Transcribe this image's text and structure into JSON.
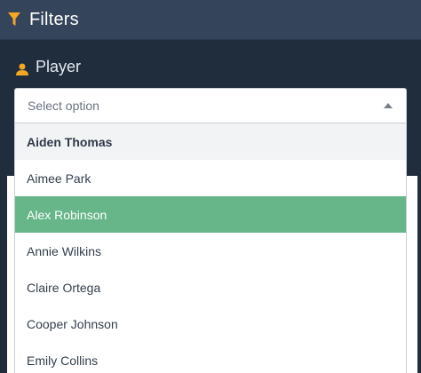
{
  "header": {
    "title": "Filters",
    "icon": "filter-icon",
    "icon_color": "#f5a623",
    "background": "#34445a"
  },
  "player_field": {
    "label": "Player",
    "icon": "user-icon",
    "icon_color": "#f5a623",
    "placeholder": "Select option"
  },
  "dropdown": {
    "options": [
      {
        "label": "Aiden Thomas",
        "state": "group-header"
      },
      {
        "label": "Aimee Park",
        "state": "normal"
      },
      {
        "label": "Alex Robinson",
        "state": "highlighted"
      },
      {
        "label": "Annie Wilkins",
        "state": "normal"
      },
      {
        "label": "Claire Ortega",
        "state": "normal"
      },
      {
        "label": "Cooper Johnson",
        "state": "normal"
      },
      {
        "label": "Emily Collins",
        "state": "normal"
      }
    ],
    "highlight_color": "#66b689"
  }
}
